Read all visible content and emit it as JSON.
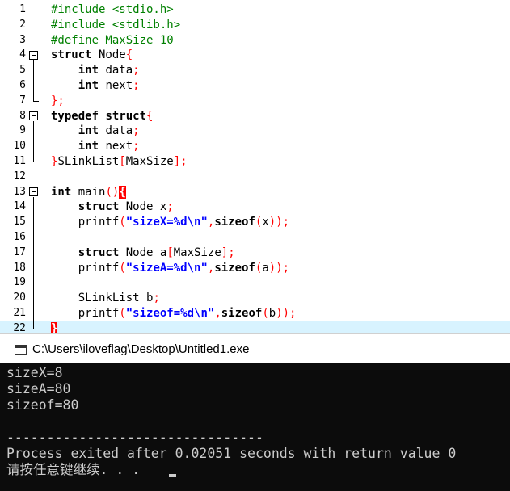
{
  "editor": {
    "lines": [
      {
        "n": "1",
        "tokens": [
          {
            "t": "#include <stdio.h>",
            "c": "pp"
          }
        ]
      },
      {
        "n": "2",
        "tokens": [
          {
            "t": "#include <stdlib.h>",
            "c": "pp"
          }
        ]
      },
      {
        "n": "3",
        "tokens": [
          {
            "t": "#define MaxSize 10",
            "c": "pp"
          }
        ]
      },
      {
        "n": "4",
        "tokens": [
          {
            "t": "struct",
            "c": "kw"
          },
          {
            "t": " Node",
            "c": "id"
          },
          {
            "t": "{",
            "c": "sym"
          }
        ]
      },
      {
        "n": "5",
        "tokens": [
          {
            "t": "    ",
            "c": "id"
          },
          {
            "t": "int",
            "c": "kw"
          },
          {
            "t": " data",
            "c": "id"
          },
          {
            "t": ";",
            "c": "sym"
          }
        ]
      },
      {
        "n": "6",
        "tokens": [
          {
            "t": "    ",
            "c": "id"
          },
          {
            "t": "int",
            "c": "kw"
          },
          {
            "t": " next",
            "c": "id"
          },
          {
            "t": ";",
            "c": "sym"
          }
        ]
      },
      {
        "n": "7",
        "tokens": [
          {
            "t": "};",
            "c": "sym"
          }
        ]
      },
      {
        "n": "8",
        "tokens": [
          {
            "t": "typedef",
            "c": "kw"
          },
          {
            "t": " ",
            "c": "id"
          },
          {
            "t": "struct",
            "c": "kw"
          },
          {
            "t": "{",
            "c": "sym"
          }
        ]
      },
      {
        "n": "9",
        "tokens": [
          {
            "t": "    ",
            "c": "id"
          },
          {
            "t": "int",
            "c": "kw"
          },
          {
            "t": " data",
            "c": "id"
          },
          {
            "t": ";",
            "c": "sym"
          }
        ]
      },
      {
        "n": "10",
        "tokens": [
          {
            "t": "    ",
            "c": "id"
          },
          {
            "t": "int",
            "c": "kw"
          },
          {
            "t": " next",
            "c": "id"
          },
          {
            "t": ";",
            "c": "sym"
          }
        ]
      },
      {
        "n": "11",
        "tokens": [
          {
            "t": "}",
            "c": "sym"
          },
          {
            "t": "SLinkList",
            "c": "id"
          },
          {
            "t": "[",
            "c": "sym"
          },
          {
            "t": "MaxSize",
            "c": "id"
          },
          {
            "t": "];",
            "c": "sym"
          }
        ]
      },
      {
        "n": "12",
        "tokens": []
      },
      {
        "n": "13",
        "tokens": [
          {
            "t": "int",
            "c": "kw"
          },
          {
            "t": " main",
            "c": "id"
          },
          {
            "t": "()",
            "c": "sym"
          },
          {
            "t": "{",
            "c": "br-hl"
          }
        ]
      },
      {
        "n": "14",
        "tokens": [
          {
            "t": "    ",
            "c": "id"
          },
          {
            "t": "struct",
            "c": "kw"
          },
          {
            "t": " Node x",
            "c": "id"
          },
          {
            "t": ";",
            "c": "sym"
          }
        ]
      },
      {
        "n": "15",
        "tokens": [
          {
            "t": "    printf",
            "c": "id"
          },
          {
            "t": "(",
            "c": "sym"
          },
          {
            "t": "\"sizeX=%d\\n\"",
            "c": "str"
          },
          {
            "t": ",",
            "c": "sym"
          },
          {
            "t": "sizeof",
            "c": "kw"
          },
          {
            "t": "(",
            "c": "sym"
          },
          {
            "t": "x",
            "c": "id"
          },
          {
            "t": "));",
            "c": "sym"
          }
        ]
      },
      {
        "n": "16",
        "tokens": []
      },
      {
        "n": "17",
        "tokens": [
          {
            "t": "    ",
            "c": "id"
          },
          {
            "t": "struct",
            "c": "kw"
          },
          {
            "t": " Node a",
            "c": "id"
          },
          {
            "t": "[",
            "c": "sym"
          },
          {
            "t": "MaxSize",
            "c": "id"
          },
          {
            "t": "];",
            "c": "sym"
          }
        ]
      },
      {
        "n": "18",
        "tokens": [
          {
            "t": "    printf",
            "c": "id"
          },
          {
            "t": "(",
            "c": "sym"
          },
          {
            "t": "\"sizeA=%d\\n\"",
            "c": "str"
          },
          {
            "t": ",",
            "c": "sym"
          },
          {
            "t": "sizeof",
            "c": "kw"
          },
          {
            "t": "(",
            "c": "sym"
          },
          {
            "t": "a",
            "c": "id"
          },
          {
            "t": "));",
            "c": "sym"
          }
        ]
      },
      {
        "n": "19",
        "tokens": []
      },
      {
        "n": "20",
        "tokens": [
          {
            "t": "    SLinkList b",
            "c": "id"
          },
          {
            "t": ";",
            "c": "sym"
          }
        ]
      },
      {
        "n": "21",
        "tokens": [
          {
            "t": "    printf",
            "c": "id"
          },
          {
            "t": "(",
            "c": "sym"
          },
          {
            "t": "\"sizeof=%d\\n\"",
            "c": "str"
          },
          {
            "t": ",",
            "c": "sym"
          },
          {
            "t": "sizeof",
            "c": "kw"
          },
          {
            "t": "(",
            "c": "sym"
          },
          {
            "t": "b",
            "c": "id"
          },
          {
            "t": "));",
            "c": "sym"
          }
        ]
      },
      {
        "n": "22",
        "tokens": [
          {
            "t": "}",
            "c": "br-hl"
          }
        ]
      }
    ],
    "current_line": "22",
    "fold_markers": [
      "4",
      "8",
      "13"
    ]
  },
  "console": {
    "title": "C:\\Users\\iloveflag\\Desktop\\Untitled1.exe",
    "lines": [
      "sizeX=8",
      "sizeA=80",
      "sizeof=80",
      "",
      "--------------------------------",
      "Process exited after 0.02051 seconds with return value 0",
      "请按任意键继续. . . "
    ]
  },
  "colors": {
    "current_line_bg": "#d8f3ff",
    "console_bg": "#0c0c0c",
    "console_text": "#cccccc",
    "preprocessor": "#008000",
    "string": "#0000ff",
    "symbol": "#ff0000"
  },
  "icons": {
    "console_icon": "console-window-icon",
    "fold_icon": "fold-collapse-icon"
  }
}
